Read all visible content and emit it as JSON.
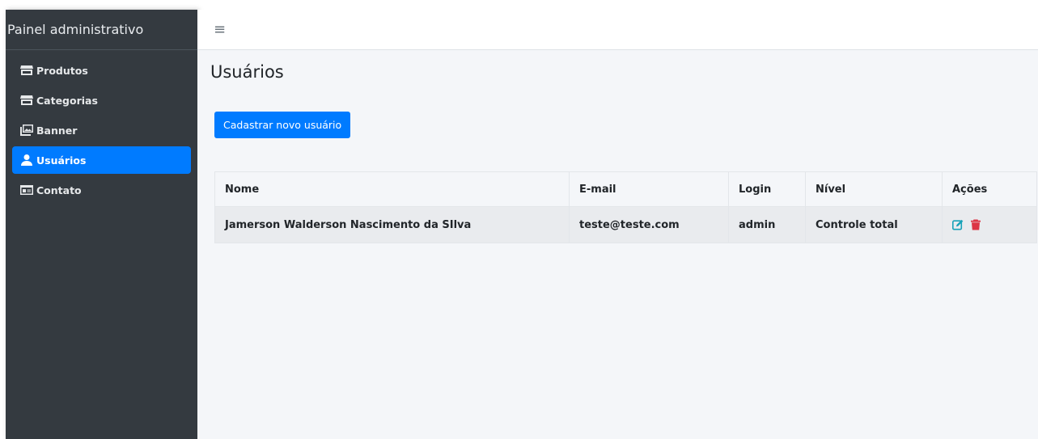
{
  "brand": "Painel administrativo",
  "nav": [
    {
      "label": "Produtos",
      "icon": "store-icon",
      "active": false
    },
    {
      "label": "Categorias",
      "icon": "store-icon",
      "active": false
    },
    {
      "label": "Banner",
      "icon": "images-icon",
      "active": false
    },
    {
      "label": "Usuários",
      "icon": "user-icon",
      "active": true
    },
    {
      "label": "Contato",
      "icon": "id-card-icon",
      "active": false
    }
  ],
  "page": {
    "title": "Usuários",
    "new_button": "Cadastrar novo usuário"
  },
  "table": {
    "headers": [
      "Nome",
      "E-mail",
      "Login",
      "Nível",
      "Ações"
    ],
    "rows": [
      {
        "nome": "Jamerson Walderson Nascimento da SIlva",
        "email": "teste@teste.com",
        "login": "admin",
        "nivel": "Controle total"
      }
    ]
  },
  "colors": {
    "sidebar": "#343a40",
    "active": "#007bff",
    "edit": "#17a2b8",
    "delete": "#dc3545",
    "content_bg": "#f4f6f9"
  }
}
